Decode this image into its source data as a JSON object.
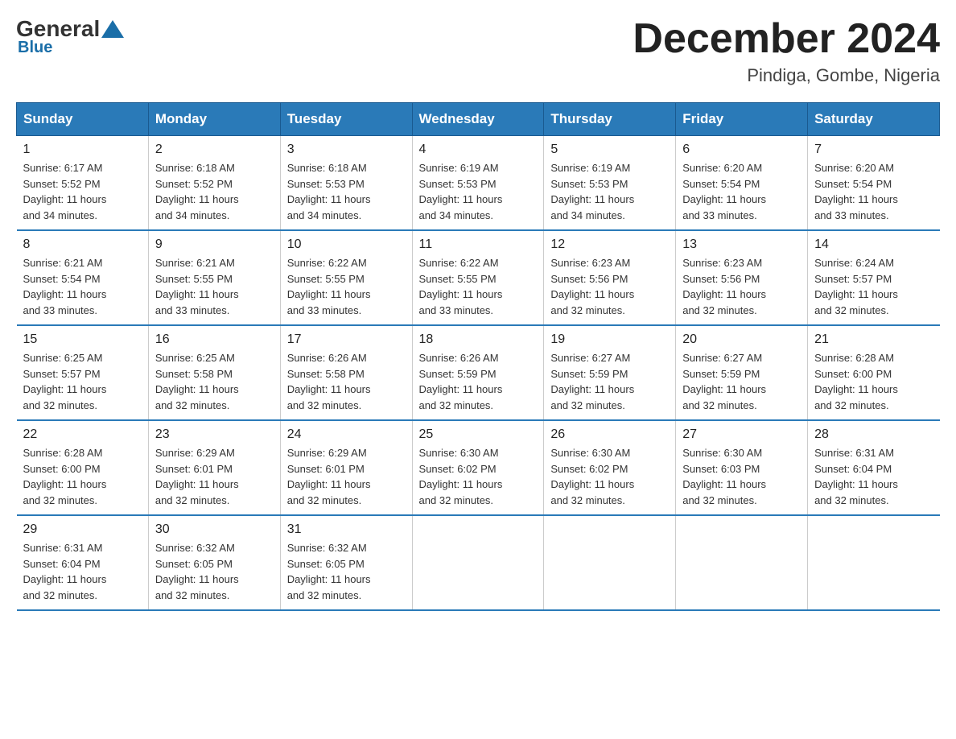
{
  "logo": {
    "general": "General",
    "blue": "Blue"
  },
  "title": "December 2024",
  "location": "Pindiga, Gombe, Nigeria",
  "headers": [
    "Sunday",
    "Monday",
    "Tuesday",
    "Wednesday",
    "Thursday",
    "Friday",
    "Saturday"
  ],
  "weeks": [
    [
      {
        "day": "1",
        "sunrise": "6:17 AM",
        "sunset": "5:52 PM",
        "daylight": "11 hours and 34 minutes."
      },
      {
        "day": "2",
        "sunrise": "6:18 AM",
        "sunset": "5:52 PM",
        "daylight": "11 hours and 34 minutes."
      },
      {
        "day": "3",
        "sunrise": "6:18 AM",
        "sunset": "5:53 PM",
        "daylight": "11 hours and 34 minutes."
      },
      {
        "day": "4",
        "sunrise": "6:19 AM",
        "sunset": "5:53 PM",
        "daylight": "11 hours and 34 minutes."
      },
      {
        "day": "5",
        "sunrise": "6:19 AM",
        "sunset": "5:53 PM",
        "daylight": "11 hours and 34 minutes."
      },
      {
        "day": "6",
        "sunrise": "6:20 AM",
        "sunset": "5:54 PM",
        "daylight": "11 hours and 33 minutes."
      },
      {
        "day": "7",
        "sunrise": "6:20 AM",
        "sunset": "5:54 PM",
        "daylight": "11 hours and 33 minutes."
      }
    ],
    [
      {
        "day": "8",
        "sunrise": "6:21 AM",
        "sunset": "5:54 PM",
        "daylight": "11 hours and 33 minutes."
      },
      {
        "day": "9",
        "sunrise": "6:21 AM",
        "sunset": "5:55 PM",
        "daylight": "11 hours and 33 minutes."
      },
      {
        "day": "10",
        "sunrise": "6:22 AM",
        "sunset": "5:55 PM",
        "daylight": "11 hours and 33 minutes."
      },
      {
        "day": "11",
        "sunrise": "6:22 AM",
        "sunset": "5:55 PM",
        "daylight": "11 hours and 33 minutes."
      },
      {
        "day": "12",
        "sunrise": "6:23 AM",
        "sunset": "5:56 PM",
        "daylight": "11 hours and 32 minutes."
      },
      {
        "day": "13",
        "sunrise": "6:23 AM",
        "sunset": "5:56 PM",
        "daylight": "11 hours and 32 minutes."
      },
      {
        "day": "14",
        "sunrise": "6:24 AM",
        "sunset": "5:57 PM",
        "daylight": "11 hours and 32 minutes."
      }
    ],
    [
      {
        "day": "15",
        "sunrise": "6:25 AM",
        "sunset": "5:57 PM",
        "daylight": "11 hours and 32 minutes."
      },
      {
        "day": "16",
        "sunrise": "6:25 AM",
        "sunset": "5:58 PM",
        "daylight": "11 hours and 32 minutes."
      },
      {
        "day": "17",
        "sunrise": "6:26 AM",
        "sunset": "5:58 PM",
        "daylight": "11 hours and 32 minutes."
      },
      {
        "day": "18",
        "sunrise": "6:26 AM",
        "sunset": "5:59 PM",
        "daylight": "11 hours and 32 minutes."
      },
      {
        "day": "19",
        "sunrise": "6:27 AM",
        "sunset": "5:59 PM",
        "daylight": "11 hours and 32 minutes."
      },
      {
        "day": "20",
        "sunrise": "6:27 AM",
        "sunset": "5:59 PM",
        "daylight": "11 hours and 32 minutes."
      },
      {
        "day": "21",
        "sunrise": "6:28 AM",
        "sunset": "6:00 PM",
        "daylight": "11 hours and 32 minutes."
      }
    ],
    [
      {
        "day": "22",
        "sunrise": "6:28 AM",
        "sunset": "6:00 PM",
        "daylight": "11 hours and 32 minutes."
      },
      {
        "day": "23",
        "sunrise": "6:29 AM",
        "sunset": "6:01 PM",
        "daylight": "11 hours and 32 minutes."
      },
      {
        "day": "24",
        "sunrise": "6:29 AM",
        "sunset": "6:01 PM",
        "daylight": "11 hours and 32 minutes."
      },
      {
        "day": "25",
        "sunrise": "6:30 AM",
        "sunset": "6:02 PM",
        "daylight": "11 hours and 32 minutes."
      },
      {
        "day": "26",
        "sunrise": "6:30 AM",
        "sunset": "6:02 PM",
        "daylight": "11 hours and 32 minutes."
      },
      {
        "day": "27",
        "sunrise": "6:30 AM",
        "sunset": "6:03 PM",
        "daylight": "11 hours and 32 minutes."
      },
      {
        "day": "28",
        "sunrise": "6:31 AM",
        "sunset": "6:04 PM",
        "daylight": "11 hours and 32 minutes."
      }
    ],
    [
      {
        "day": "29",
        "sunrise": "6:31 AM",
        "sunset": "6:04 PM",
        "daylight": "11 hours and 32 minutes."
      },
      {
        "day": "30",
        "sunrise": "6:32 AM",
        "sunset": "6:05 PM",
        "daylight": "11 hours and 32 minutes."
      },
      {
        "day": "31",
        "sunrise": "6:32 AM",
        "sunset": "6:05 PM",
        "daylight": "11 hours and 32 minutes."
      },
      null,
      null,
      null,
      null
    ]
  ],
  "labels": {
    "sunrise": "Sunrise:",
    "sunset": "Sunset:",
    "daylight": "Daylight:"
  }
}
